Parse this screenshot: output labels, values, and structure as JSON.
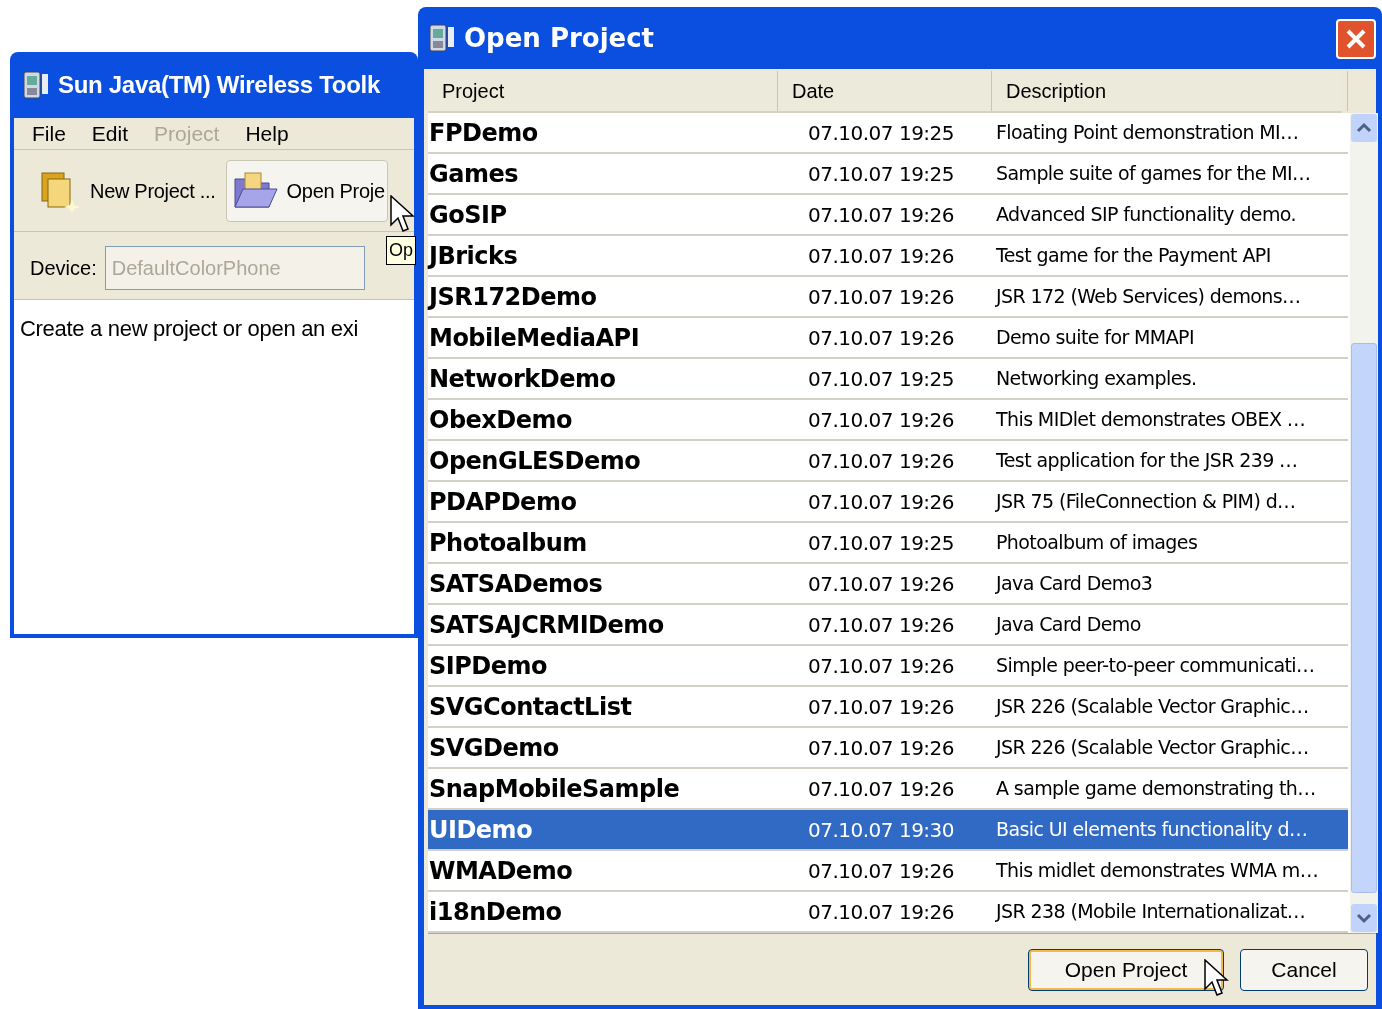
{
  "main_window": {
    "title": "Sun Java(TM) Wireless Toolk",
    "menu": [
      {
        "label": "File",
        "disabled": false
      },
      {
        "label": "Edit",
        "disabled": false
      },
      {
        "label": "Project",
        "disabled": true
      },
      {
        "label": "Help",
        "disabled": false
      }
    ],
    "toolbar": [
      {
        "label": "New Project ...",
        "kind": "new",
        "hovered": false
      },
      {
        "label": "Open Proje",
        "kind": "open",
        "hovered": true
      }
    ],
    "tooltip": "Op",
    "device": {
      "label": "Device:",
      "value": "DefaultColorPhone"
    },
    "message": "Create a new project or open an exi"
  },
  "dialog": {
    "title": "Open Project",
    "columns": [
      "Project",
      "Date",
      "Description"
    ],
    "rows": [
      {
        "project": "FPDemo",
        "date": "07.10.07 19:25",
        "description": "Floating Point demonstration MI…",
        "selected": false
      },
      {
        "project": "Games",
        "date": "07.10.07 19:25",
        "description": "Sample suite of games for the MI…",
        "selected": false
      },
      {
        "project": "GoSIP",
        "date": "07.10.07 19:26",
        "description": "Advanced SIP functionality demo.",
        "selected": false
      },
      {
        "project": "JBricks",
        "date": "07.10.07 19:26",
        "description": "Test game for the Payment API",
        "selected": false
      },
      {
        "project": "JSR172Demo",
        "date": "07.10.07 19:26",
        "description": "JSR 172 (Web Services) demons…",
        "selected": false
      },
      {
        "project": "MobileMediaAPI",
        "date": "07.10.07 19:26",
        "description": "Demo suite for MMAPI",
        "selected": false
      },
      {
        "project": "NetworkDemo",
        "date": "07.10.07 19:25",
        "description": "Networking examples.",
        "selected": false
      },
      {
        "project": "ObexDemo",
        "date": "07.10.07 19:26",
        "description": "This MIDlet demonstrates OBEX …",
        "selected": false
      },
      {
        "project": "OpenGLESDemo",
        "date": "07.10.07 19:26",
        "description": "Test application for the JSR 239 …",
        "selected": false
      },
      {
        "project": "PDAPDemo",
        "date": "07.10.07 19:26",
        "description": "JSR 75 (FileConnection & PIM) d…",
        "selected": false
      },
      {
        "project": "Photoalbum",
        "date": "07.10.07 19:25",
        "description": "Photoalbum of images",
        "selected": false
      },
      {
        "project": "SATSADemos",
        "date": "07.10.07 19:26",
        "description": "Java Card Demo3",
        "selected": false
      },
      {
        "project": "SATSAJCRMIDemo",
        "date": "07.10.07 19:26",
        "description": "Java Card Demo",
        "selected": false
      },
      {
        "project": "SIPDemo",
        "date": "07.10.07 19:26",
        "description": "Simple peer-to-peer communicati…",
        "selected": false
      },
      {
        "project": "SVGContactList",
        "date": "07.10.07 19:26",
        "description": "JSR 226 (Scalable Vector Graphic…",
        "selected": false
      },
      {
        "project": "SVGDemo",
        "date": "07.10.07 19:26",
        "description": "JSR 226 (Scalable Vector Graphic…",
        "selected": false
      },
      {
        "project": "SnapMobileSample",
        "date": "07.10.07 19:26",
        "description": "A sample game demonstrating th…",
        "selected": false
      },
      {
        "project": "UIDemo",
        "date": "07.10.07 19:30",
        "description": "Basic UI elements functionality d…",
        "selected": true
      },
      {
        "project": "WMADemo",
        "date": "07.10.07 19:26",
        "description": "This midlet demonstrates WMA m…",
        "selected": false
      },
      {
        "project": "i18nDemo",
        "date": "07.10.07 19:26",
        "description": "JSR 238 (Mobile Internationalizat…",
        "selected": false
      }
    ],
    "buttons": [
      {
        "label": "Open Project",
        "default": true
      },
      {
        "label": "Cancel",
        "default": false
      }
    ]
  }
}
